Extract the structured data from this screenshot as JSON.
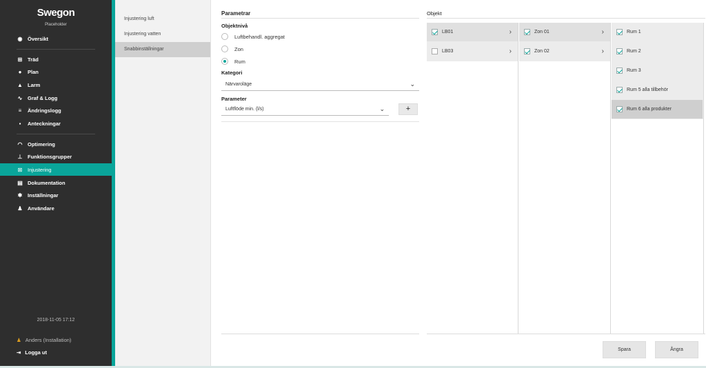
{
  "brand": {
    "logo": "Swegon",
    "subtitle": "Placeholder"
  },
  "nav": {
    "overview": "Översikt",
    "items1": [
      "Träd",
      "Plan",
      "Larm",
      "Graf & Logg",
      "Ändringslogg",
      "Anteckningar"
    ],
    "items2": [
      "Optimering",
      "Funktionsgrupper",
      "Injustering",
      "Dokumentation",
      "Inställningar",
      "Användare"
    ],
    "active": "Injustering",
    "datetime": "2018-11-05 17:12",
    "user": "Anders (Installation)",
    "logout": "Logga ut"
  },
  "submenu": [
    "Injustering luft",
    "Injustering vatten",
    "Snabbinställningar"
  ],
  "params": {
    "title": "Parametrar",
    "level_label": "Objektnivå",
    "levels": [
      "Luftbehandl. aggregat",
      "Zon",
      "Rum"
    ],
    "level_selected": "Rum",
    "category_label": "Kategori",
    "category_value": "Närvaroläge",
    "parameter_label": "Parameter",
    "parameter_value": "Luftflöde min. (l/s)",
    "add_label": "+"
  },
  "objekt": {
    "title": "Objekt",
    "col1": [
      {
        "label": "LB01",
        "checked": true
      },
      {
        "label": "LB03",
        "checked": false
      }
    ],
    "col2": [
      {
        "label": "Zon 01",
        "checked": true
      },
      {
        "label": "Zon 02",
        "checked": true
      }
    ],
    "col3": [
      {
        "label": "Rum 1",
        "checked": true
      },
      {
        "label": "Rum 2",
        "checked": true
      },
      {
        "label": "Rum 3",
        "checked": true
      },
      {
        "label": "Rum 5 alla tillbehör",
        "checked": true
      },
      {
        "label": "Rum 6 alla produkter",
        "checked": true
      }
    ]
  },
  "actions": {
    "save": "Spara",
    "undo": "Ångra"
  },
  "colors": {
    "accent": "#0aa59a",
    "sidebar": "#2e2e2e"
  }
}
